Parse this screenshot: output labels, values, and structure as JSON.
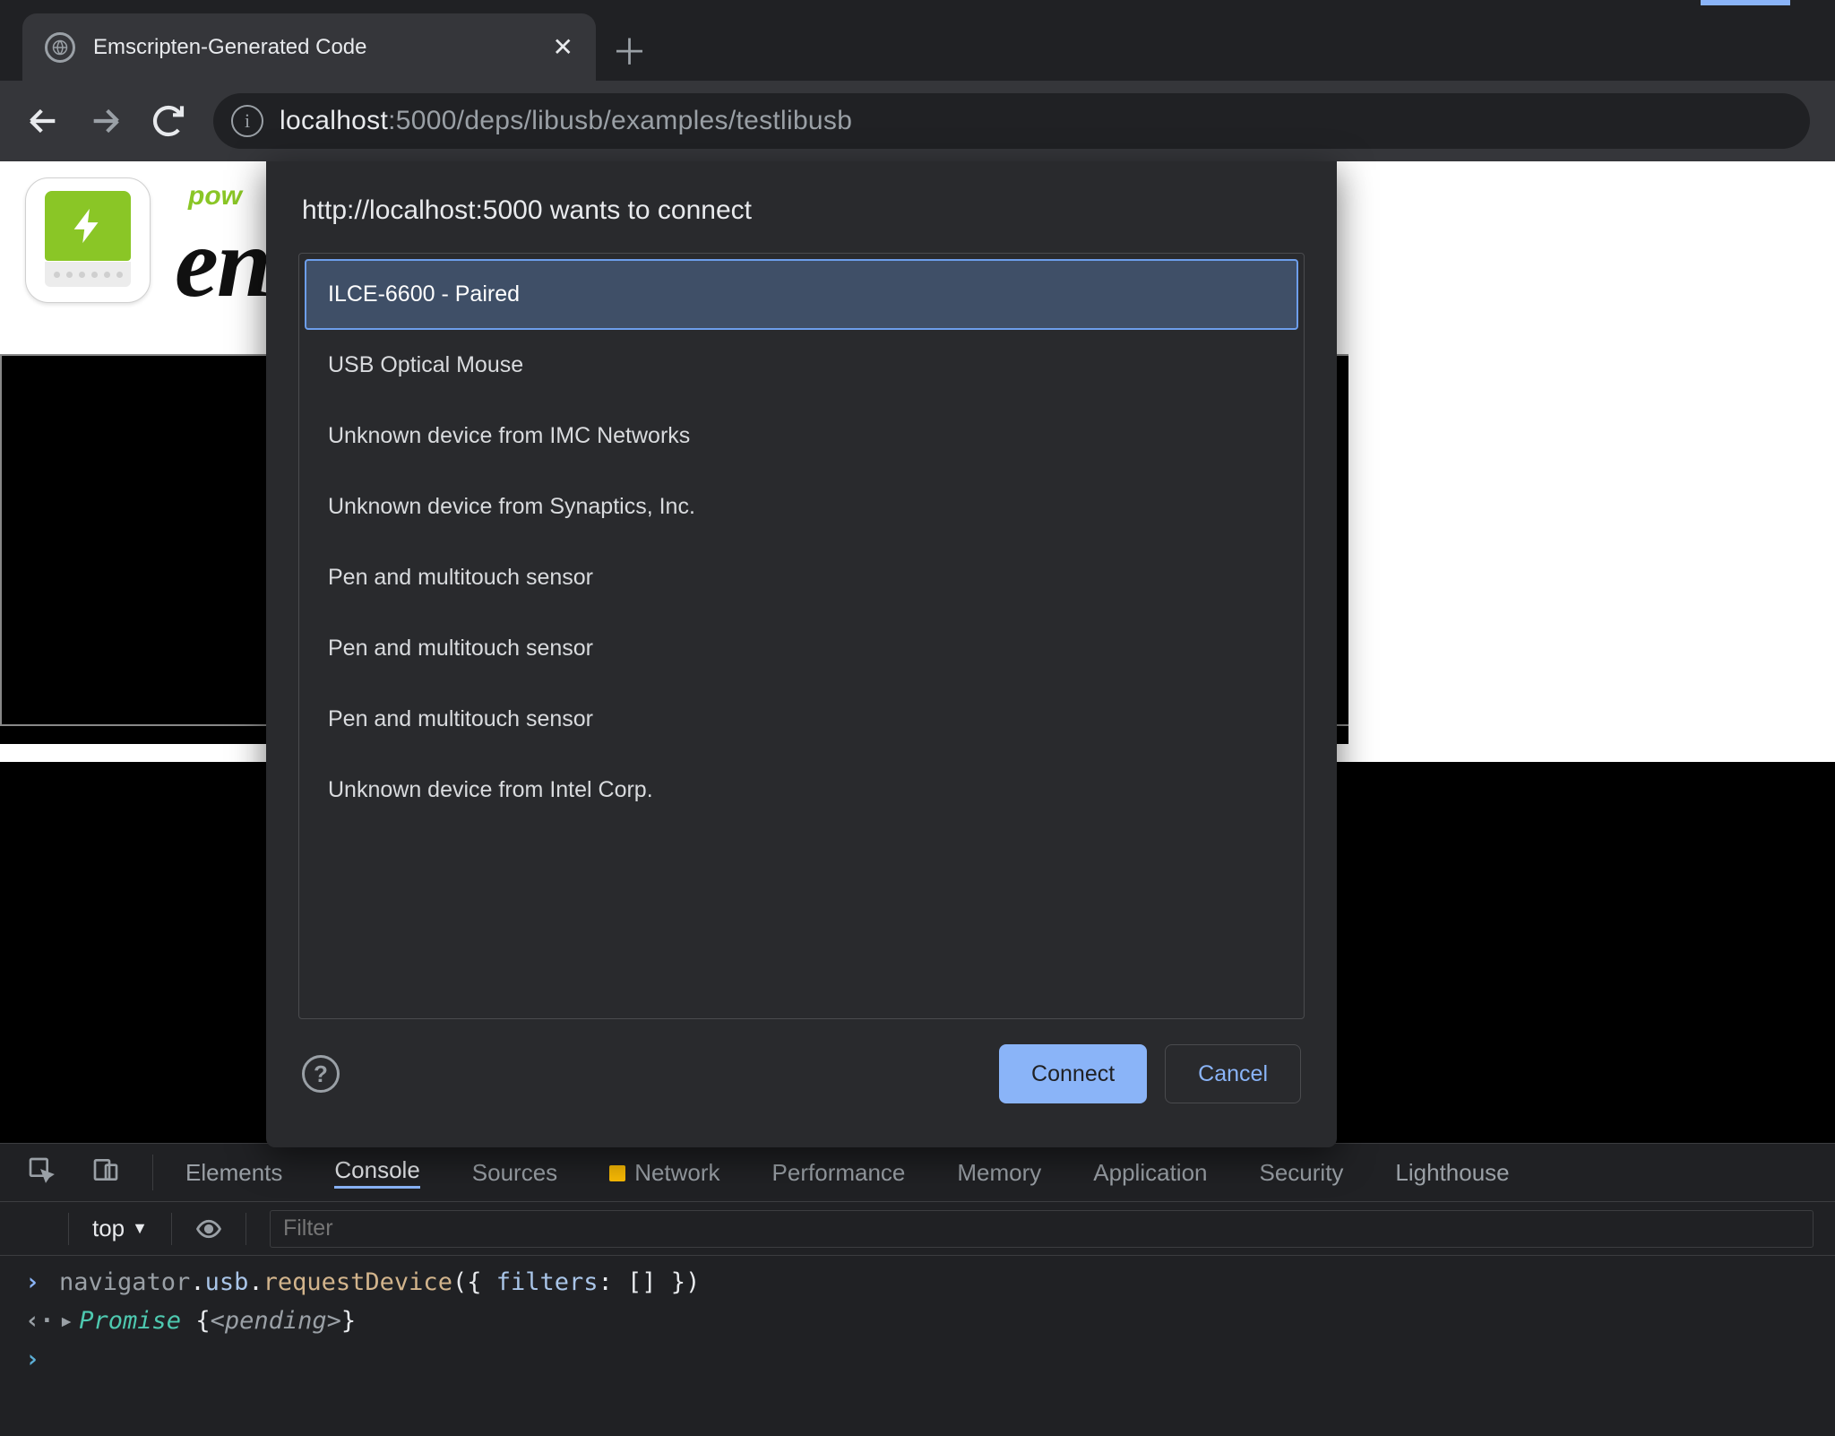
{
  "browser": {
    "tab_title": "Emscripten-Generated Code",
    "url_host": "localhost",
    "url_port_path": ":5000/deps/libusb/examples/testlibusb"
  },
  "page": {
    "pow_text": "pow",
    "em_text": "en"
  },
  "dialog": {
    "title": "http://localhost:5000 wants to connect",
    "devices": [
      "ILCE-6600 - Paired",
      "USB Optical Mouse",
      "Unknown device from IMC Networks",
      "Unknown device from Synaptics, Inc.",
      "Pen and multitouch sensor",
      "Pen and multitouch sensor",
      "Pen and multitouch sensor",
      "Unknown device from Intel Corp."
    ],
    "selected_index": 0,
    "connect_label": "Connect",
    "cancel_label": "Cancel"
  },
  "devtools": {
    "tabs": [
      "Elements",
      "Console",
      "Sources",
      "Network",
      "Performance",
      "Memory",
      "Application",
      "Security",
      "Lighthouse"
    ],
    "active_tab": "Console",
    "context_label": "top",
    "filter_placeholder": "Filter",
    "console": {
      "input": "navigator.usb.requestDevice({ filters: [] })",
      "output_prefix": "Promise",
      "output_state": "<pending>"
    }
  }
}
